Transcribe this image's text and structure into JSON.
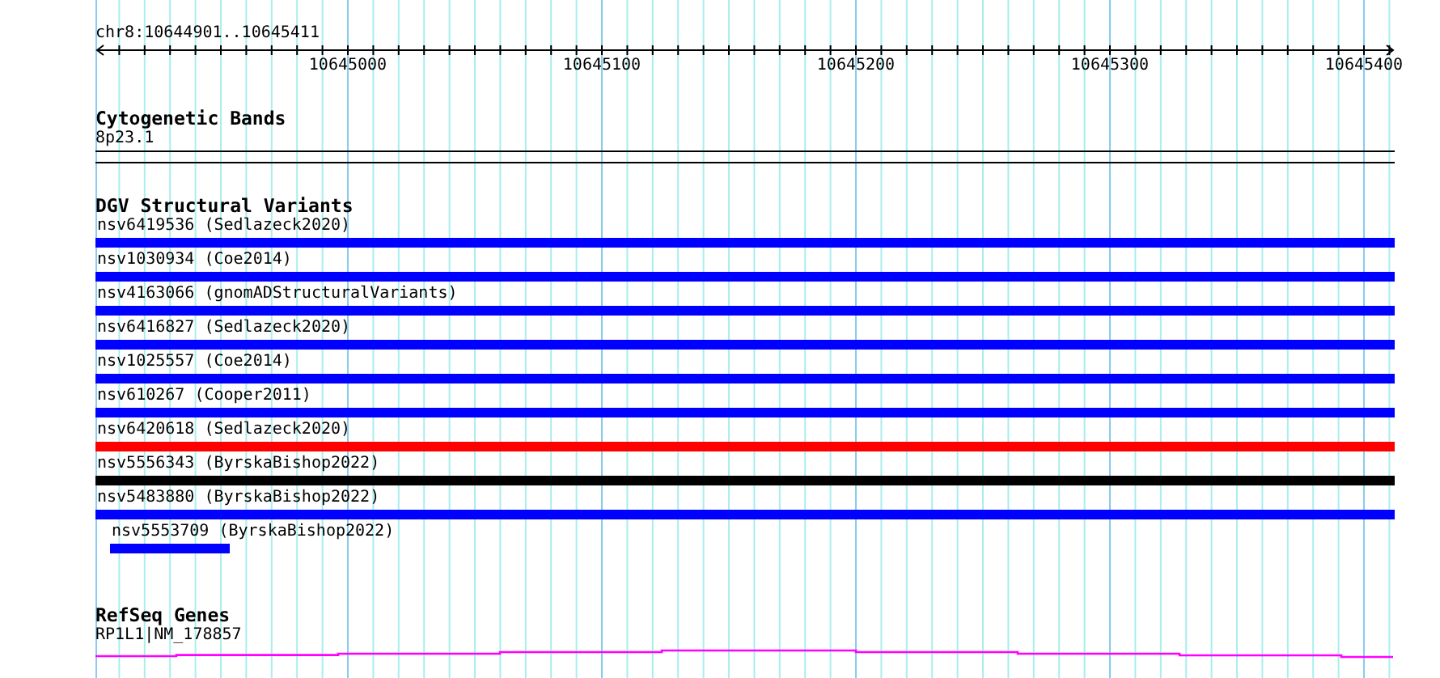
{
  "ruler": {
    "location": "chr8:10644901..10645411",
    "labels": [
      "10645000",
      "10645100",
      "10645200",
      "10645300",
      "10645400"
    ]
  },
  "tracks": [
    {
      "kind": "band",
      "title": "Cytogenetic Bands",
      "label": "8p23.1"
    },
    {
      "kind": "variants",
      "title": "DGV Structural Variants",
      "features": [
        {
          "label": "nsv6419536 (Sedlazeck2020)",
          "color": "#0000ff",
          "kind": "full"
        },
        {
          "label": "nsv1030934 (Coe2014)",
          "color": "#0000ff",
          "kind": "full"
        },
        {
          "label": "nsv4163066 (gnomADStructuralVariants)",
          "color": "#0000ff",
          "kind": "full"
        },
        {
          "label": "nsv6416827 (Sedlazeck2020)",
          "color": "#0000ff",
          "kind": "full"
        },
        {
          "label": "nsv1025557 (Coe2014)",
          "color": "#0000ff",
          "kind": "full"
        },
        {
          "label": "nsv610267 (Cooper2011)",
          "color": "#0000ff",
          "kind": "full"
        },
        {
          "label": "nsv6420618 (Sedlazeck2020)",
          "color": "#ff0000",
          "kind": "full"
        },
        {
          "label": "nsv5556343 (ByrskaBishop2022)",
          "color": "#000000",
          "kind": "full"
        },
        {
          "label": "nsv5483880 (ByrskaBishop2022)",
          "color": "#0000ff",
          "kind": "full"
        },
        {
          "label": "nsv5553709 (ByrskaBishop2022)",
          "color": "#0000ff",
          "kind": "partial"
        }
      ]
    },
    {
      "kind": "gene",
      "title": "RefSeq Genes",
      "label": "RP1L1|NM_178857"
    }
  ]
}
